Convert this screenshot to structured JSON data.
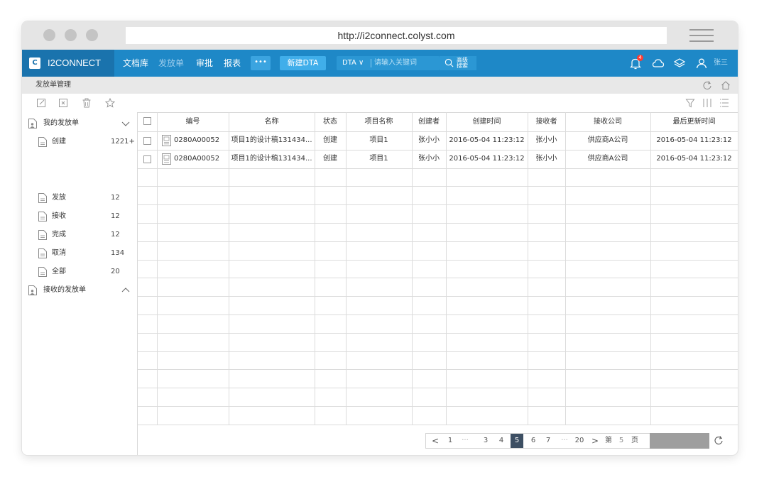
{
  "browser": {
    "url": "http://i2connect.colyst.com"
  },
  "navbar": {
    "logo_mark": "C",
    "logo_text": "I2CONNECT",
    "items": [
      "文档库",
      "发放单",
      "审批",
      "报表"
    ],
    "more_label": "•••",
    "new_button": "新建DTA",
    "search_type": "DTA ∨",
    "search_placeholder": "请输入关键词",
    "advanced_search": "高级搜索",
    "notification_count": "4",
    "user_name": "张三"
  },
  "breadcrumb": "发放单管理",
  "sidebar": {
    "sections": [
      {
        "label": "我的发放单",
        "expanded": true
      },
      {
        "label": "接收的发放单",
        "expanded": false
      }
    ],
    "items": [
      {
        "label": "创建",
        "count": "1221+"
      },
      {
        "label": "发放",
        "count": "12"
      },
      {
        "label": "接收",
        "count": "12"
      },
      {
        "label": "完成",
        "count": "12"
      },
      {
        "label": "取消",
        "count": "134"
      },
      {
        "label": "全部",
        "count": "20"
      }
    ]
  },
  "table": {
    "columns": [
      "编号",
      "名称",
      "状态",
      "项目名称",
      "创建者",
      "创建时间",
      "接收者",
      "接收公司",
      "最后更新时间"
    ],
    "rows": [
      [
        "0280A00052",
        "项目1的设计稿131434...",
        "创建",
        "项目1",
        "张小小",
        "2016-05-04 11:23:12",
        "张小小",
        "供应商A公司",
        "2016-05-04 11:23:12"
      ],
      [
        "0280A00052",
        "项目1的设计稿131434...",
        "创建",
        "项目1",
        "张小小",
        "2016-05-04 11:23:12",
        "张小小",
        "供应商A公司",
        "2016-05-04 11:23:12"
      ]
    ]
  },
  "pager": {
    "prev": "<",
    "next": ">",
    "first": "1",
    "ellipsis": "···",
    "pages": [
      "3",
      "4",
      "5",
      "6",
      "7"
    ],
    "current": "5",
    "last": "20",
    "goto_prefix": "第",
    "goto_value": "5",
    "goto_suffix": "页"
  },
  "colors": {
    "navbar": "#1e88c7",
    "logo_bg": "#1a73ad",
    "active_page": "#3d4f63",
    "badge": "#ff3b30"
  }
}
